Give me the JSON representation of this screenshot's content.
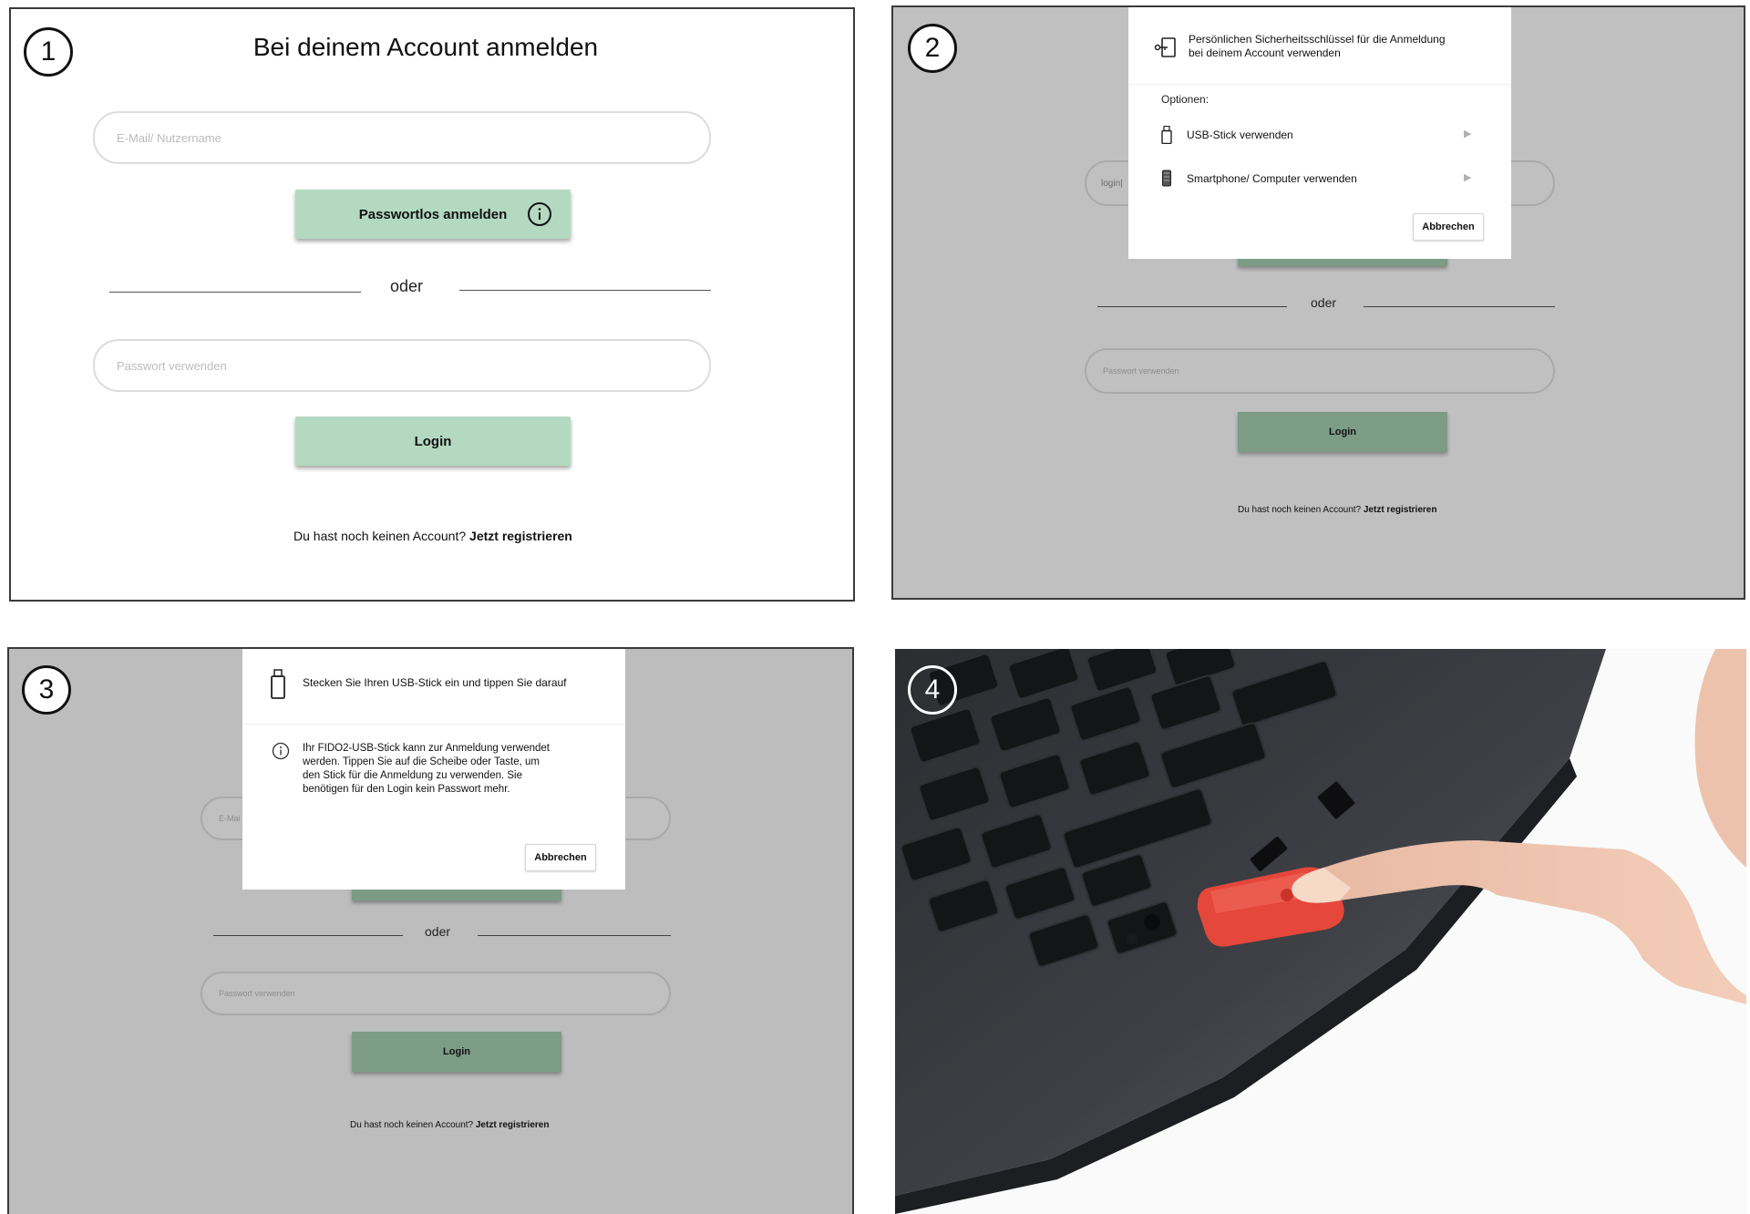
{
  "panel1": {
    "step": "1",
    "title": "Bei deinem Account anmelden",
    "email_placeholder": "E-Mail/ Nutzername",
    "passwordless_button": "Passwortlos anmelden",
    "or": "oder",
    "password_placeholder": "Passwort verwenden",
    "login_button": "Login",
    "no_account": "Du hast noch keinen Account?",
    "register_link": "Jetzt registrieren"
  },
  "panel2": {
    "step": "2",
    "dialog_title_line1": "Persönlichen Sicherheitsschlüssel für die Anmeldung",
    "dialog_title_line2": "bei deinem Account verwenden",
    "options_label": "Optionen:",
    "option_usb": "USB-Stick verwenden",
    "option_phone": "Smartphone/ Computer verwenden",
    "cancel_button": "Abbrechen",
    "field_partial": "login|",
    "or": "oder",
    "password_placeholder": "Passwort verwenden",
    "login_button": "Login",
    "no_account": "Du hast noch keinen Account?",
    "register_link": "Jetzt registrieren"
  },
  "panel3": {
    "step": "3",
    "dialog_title": "Stecken Sie Ihren USB-Stick ein und tippen Sie darauf",
    "info_line1": "Ihr FIDO2-USB-Stick kann zur Anmeldung verwendet",
    "info_line2": "werden. Tippen Sie auf die Scheibe oder Taste, um",
    "info_line3": "den Stick für die Anmeldung zu verwenden. Sie",
    "info_line4": "benötigen für den Login kein Passwort mehr.",
    "cancel_button": "Abbrechen",
    "field_partial": "E-Mai",
    "or": "oder",
    "password_placeholder": "Passwort verwenden",
    "login_button": "Login",
    "no_account": "Du hast noch keinen Account?",
    "register_link": "Jetzt registrieren"
  },
  "panel4": {
    "step": "4",
    "photo_subject": "finger-touching-usb-security-key-in-laptop"
  },
  "colors": {
    "accent_green": "#b3d9c1",
    "dim_green": "#7c9c86",
    "overlay_gray": "#c0c0c0",
    "usb_key_red": "#e5473a"
  }
}
